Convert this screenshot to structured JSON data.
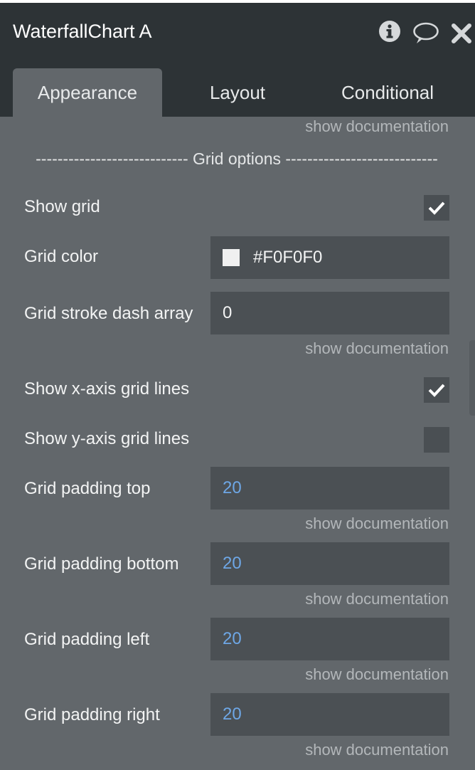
{
  "window": {
    "title": "WaterfallChart A"
  },
  "tabs": [
    {
      "label": "Appearance",
      "active": true
    },
    {
      "label": "Layout",
      "active": false
    },
    {
      "label": "Conditional",
      "active": false
    }
  ],
  "doc_link": "show documentation",
  "section": {
    "label": "---------------------------- Grid options ----------------------------"
  },
  "fields": {
    "show_grid": {
      "label": "Show grid",
      "checked": true
    },
    "grid_color": {
      "label": "Grid color",
      "value": "#F0F0F0",
      "swatch": "#F0F0F0"
    },
    "dash_array": {
      "label": "Grid stroke dash array",
      "value": "0"
    },
    "show_x_grid": {
      "label": "Show x-axis grid lines",
      "checked": true
    },
    "show_y_grid": {
      "label": "Show y-axis grid lines",
      "checked": false
    },
    "pad_top": {
      "label": "Grid padding top",
      "value": "20"
    },
    "pad_bottom": {
      "label": "Grid padding bottom",
      "value": "20"
    },
    "pad_left": {
      "label": "Grid padding left",
      "value": "20"
    },
    "pad_right": {
      "label": "Grid padding right",
      "value": "20"
    }
  },
  "icons": [
    "info-icon",
    "comment-icon",
    "close-icon",
    "checkmark-icon"
  ],
  "colors": {
    "panel": "#62676b",
    "header": "#2d3336",
    "field": "#4b5054",
    "accent_value": "#6ea7e6"
  }
}
